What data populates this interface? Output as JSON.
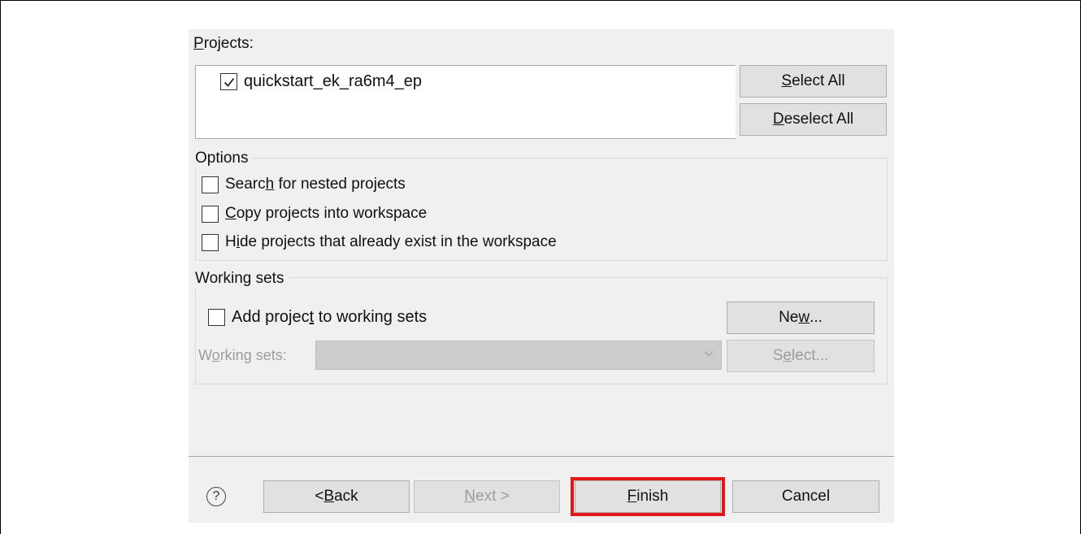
{
  "projects": {
    "label_before": "",
    "label_u": "P",
    "label_after": "rojects:",
    "items": [
      {
        "name": "quickstart_ek_ra6m4_ep",
        "checked": true
      }
    ],
    "select_all": {
      "u": "S",
      "rest": "elect All"
    },
    "deselect_all": {
      "u": "D",
      "rest": "eselect All"
    }
  },
  "options": {
    "title": "Options",
    "items": [
      {
        "before": "Searc",
        "u": "h",
        "after": " for nested projects",
        "checked": false
      },
      {
        "before": "",
        "u": "C",
        "after": "opy projects into workspace",
        "checked": false
      },
      {
        "before": "H",
        "u": "i",
        "after": "de projects that already exist in the workspace",
        "checked": false
      }
    ]
  },
  "working_sets": {
    "title": "Working sets",
    "add": {
      "before": "Add projec",
      "u": "t",
      "after": " to working sets",
      "checked": false
    },
    "new_button": {
      "before": "Ne",
      "u": "w",
      "after": "..."
    },
    "combo_label": {
      "before": "W",
      "u": "o",
      "after": "rking sets:"
    },
    "combo_value": "",
    "select_button": {
      "before": "S",
      "u": "e",
      "after": "lect..."
    }
  },
  "footer": {
    "help": "?",
    "back": {
      "before": "< ",
      "u": "B",
      "after": "ack"
    },
    "next": {
      "before": "",
      "u": "N",
      "after": "ext >"
    },
    "finish": {
      "before": "",
      "u": "F",
      "after": "inish"
    },
    "cancel": "Cancel"
  },
  "colors": {
    "highlight": "#e3161c",
    "dialog_bg": "#f0f0f0",
    "button_bg": "#e1e1e1",
    "disabled_text": "#9d9d9d"
  }
}
